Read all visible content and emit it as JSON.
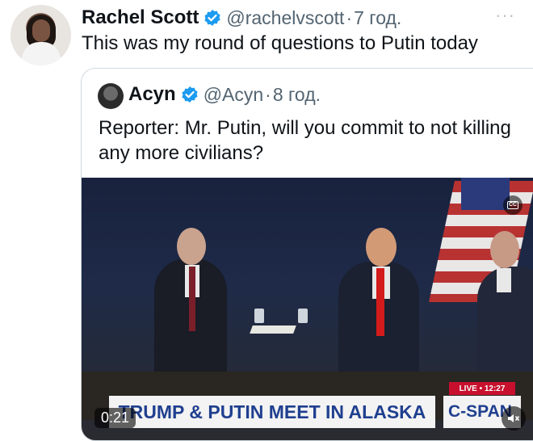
{
  "tweet": {
    "author_name": "Rachel Scott",
    "handle": "@rachelvscott",
    "separator": "·",
    "time": "7 год.",
    "text": "This was my round of questions to Putin today",
    "more_icon": "ellipsis-icon"
  },
  "quote": {
    "author_name": "Acyn",
    "handle": "@Acyn",
    "separator": "·",
    "time": "8 год.",
    "text": "Reporter: Mr. Putin, will you commit to not killing any more civilians?"
  },
  "video": {
    "cc_label": "CC",
    "live_label": "LIVE • 12:27",
    "banner": "TRUMP & PUTIN MEET IN ALASKA",
    "network": "C-SPAN",
    "timer": "0:21",
    "mute_icon": "speaker-muted-icon"
  },
  "colors": {
    "verified": "#1d9bf0",
    "secondary_text": "#536471",
    "border": "#cfd9de"
  }
}
